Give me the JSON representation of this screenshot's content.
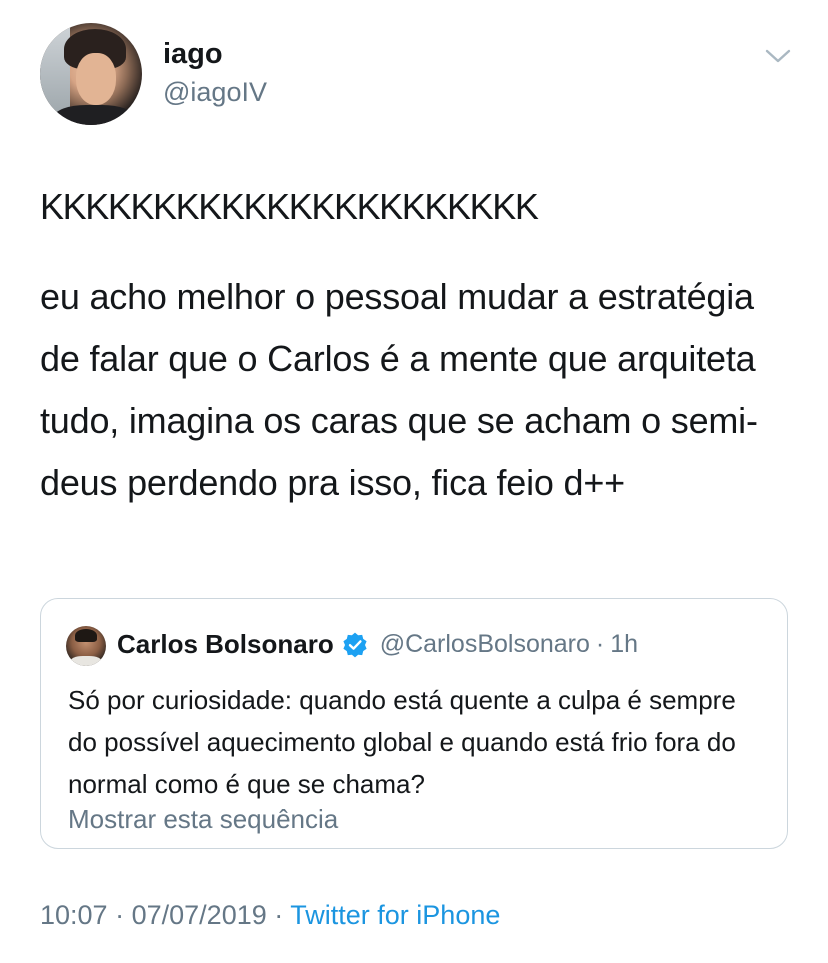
{
  "author": {
    "name": "iago",
    "handle": "@iagoIV"
  },
  "tweet": {
    "lines": [
      "KKKKKKKKKKKKKKKKKKKKKK",
      "eu acho melhor o pessoal mudar a estratégia de falar que o Carlos é a mente que arquiteta tudo, imagina os caras que se acham o semi-deus perdendo pra isso, fica feio d++"
    ]
  },
  "quoted_tweet": {
    "name": "Carlos Bolsonaro",
    "handle": "@CarlosBolsonaro",
    "separator": "·",
    "time": "1h",
    "text": "Só por curiosidade: quando está quente a culpa é sempre do possível aquecimento global e quando está frio fora do normal como é que se chama?",
    "show_thread": "Mostrar esta sequência",
    "verified_color": "#1da1f2"
  },
  "meta": {
    "time": "10:07",
    "separator": "·",
    "date": "07/07/2019",
    "source": "Twitter for iPhone"
  },
  "icons": {
    "menu": "chevron-down-icon",
    "verified": "verified-badge-icon"
  },
  "colors": {
    "text": "#14171a",
    "secondary": "#657786",
    "link": "#1b95e0",
    "border": "#ccd6dd"
  }
}
